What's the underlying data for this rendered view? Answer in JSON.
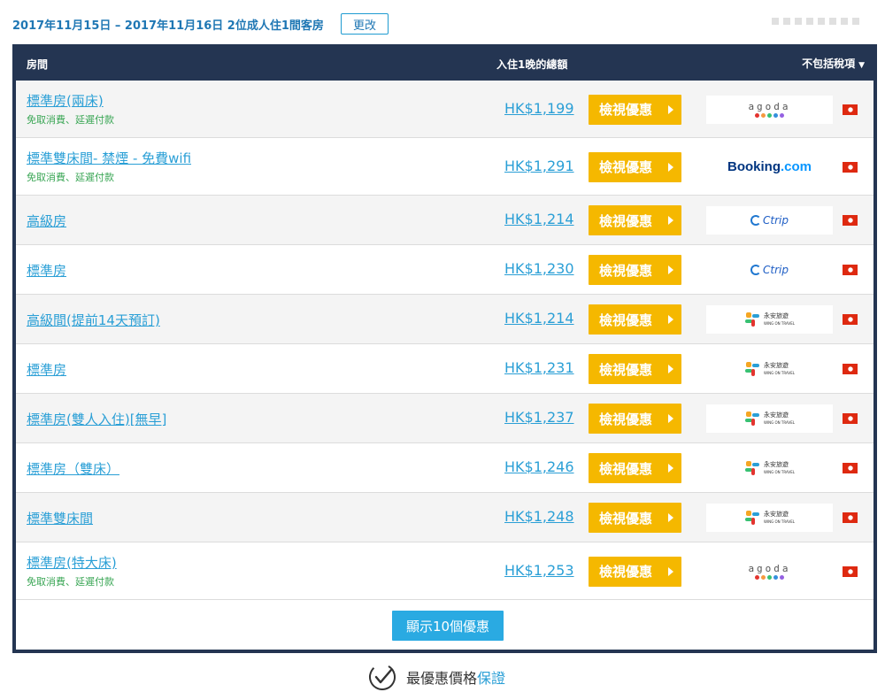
{
  "search": {
    "summary": "2017年11月15日 – 2017年11月16日 2位成人住1間客房",
    "change_label": "更改"
  },
  "table": {
    "header_room": "房間",
    "header_price": "入住1晚的總額",
    "header_tax": "不包括稅項"
  },
  "rows": [
    {
      "name": "標準房(兩床)",
      "note": "免取消費、延遲付款",
      "price": "HK$1,199",
      "button": "檢視優惠",
      "provider": "agoda"
    },
    {
      "name": "標準雙床間- 禁煙 - 免費wifi",
      "note": "免取消費、延遲付款",
      "price": "HK$1,291",
      "button": "檢視優惠",
      "provider": "booking"
    },
    {
      "name": "高級房",
      "note": "",
      "price": "HK$1,214",
      "button": "檢視優惠",
      "provider": "ctrip"
    },
    {
      "name": "標準房",
      "note": "",
      "price": "HK$1,230",
      "button": "檢視優惠",
      "provider": "ctrip"
    },
    {
      "name": "高級間(提前14天預訂)",
      "note": "",
      "price": "HK$1,214",
      "button": "檢視優惠",
      "provider": "wingon"
    },
    {
      "name": "標準房",
      "note": "",
      "price": "HK$1,231",
      "button": "檢視優惠",
      "provider": "wingon"
    },
    {
      "name": "標準房(雙人入住)[無早]",
      "note": "",
      "price": "HK$1,237",
      "button": "檢視優惠",
      "provider": "wingon"
    },
    {
      "name": "標準房（雙床）",
      "note": "",
      "price": "HK$1,246",
      "button": "檢視優惠",
      "provider": "wingon"
    },
    {
      "name": "標準雙床間",
      "note": "",
      "price": "HK$1,248",
      "button": "檢視優惠",
      "provider": "wingon"
    },
    {
      "name": "標準房(特大床)",
      "note": "免取消費、延遲付款",
      "price": "HK$1,253",
      "button": "檢視優惠",
      "provider": "agoda"
    }
  ],
  "logos": {
    "agoda": "agoda",
    "booking_main": "Booking",
    "booking_suffix": ".com",
    "ctrip": "Ctrip",
    "wingon_cn": "永安旅遊",
    "wingon_en": "WING ON TRAVEL"
  },
  "more_button": "顯示10個優惠",
  "guarantee": {
    "text": "最優惠價格",
    "link": "保證"
  },
  "colors": {
    "header_bg": "#243552",
    "deal_button": "#f5b800",
    "link_blue": "#2a9fd6",
    "note_green": "#3aa655"
  },
  "icons": {
    "flag": "hong-kong-flag-icon",
    "guarantee": "check-circle-icon",
    "dropdown": "caret-down-icon"
  }
}
